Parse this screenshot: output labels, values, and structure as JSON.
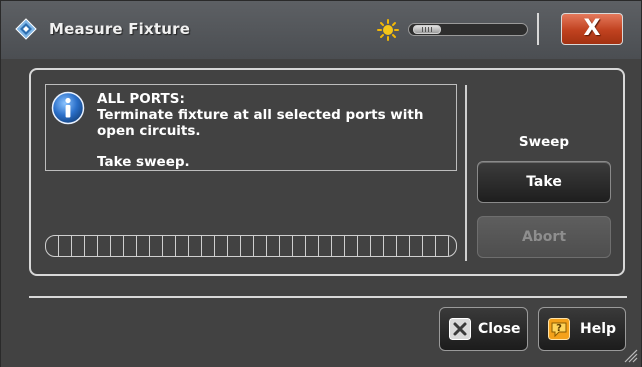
{
  "window": {
    "title": "Measure Fixture",
    "close_symbol": "X"
  },
  "icons": {
    "app": "rohde-diamond-icon",
    "brightness": "sun-icon",
    "info": "info-icon",
    "close": "close-x-icon",
    "help": "help-question-icon"
  },
  "brightness": {
    "level": 0.1
  },
  "message": {
    "line1": "ALL PORTS:",
    "line2": "Terminate fixture at all selected ports with",
    "line3": "open circuits.",
    "line4": "Take sweep."
  },
  "progress": {
    "value": 0
  },
  "sweep": {
    "label": "Sweep",
    "take_label": "Take",
    "abort_label": "Abort"
  },
  "footer": {
    "close_label": "Close",
    "help_label": "Help"
  },
  "colors": {
    "close_red": "#c0411f",
    "help_orange": "#f4a11a",
    "info_blue": "#2a6fc9"
  }
}
